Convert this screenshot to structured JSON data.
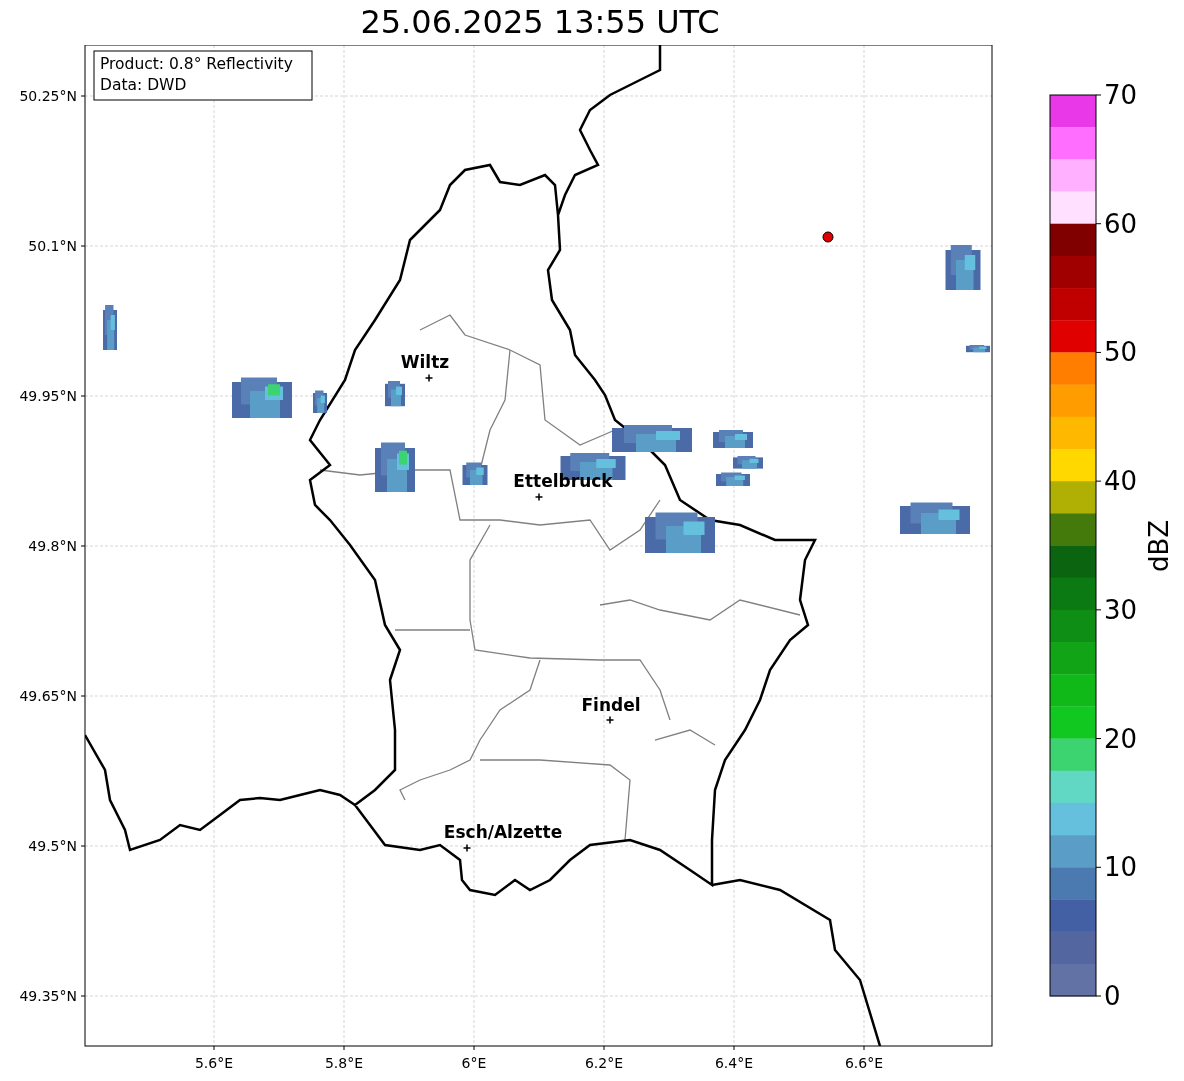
{
  "title": "25.06.2025 13:55 UTC",
  "info_box": [
    "Product: 0.8° Reflectivity",
    "Data: DWD"
  ],
  "map": {
    "cities": [
      {
        "name": "Wiltz"
      },
      {
        "name": "Ettelbruck"
      },
      {
        "name": "Findel"
      },
      {
        "name": "Esch/Alzette"
      }
    ],
    "x_ticks": [
      "5.6°E",
      "5.8°E",
      "6°E",
      "6.2°E",
      "6.4°E",
      "6.6°E"
    ],
    "y_ticks": [
      "50.25°N",
      "50.1°N",
      "49.95°N",
      "49.8°N",
      "49.65°N",
      "49.5°N",
      "49.35°N"
    ]
  },
  "colorbar": {
    "label": "dBZ",
    "ticks": [
      "70",
      "60",
      "50",
      "40",
      "30",
      "20",
      "10",
      "0"
    ],
    "segments": [
      {
        "color": "#e838e8"
      },
      {
        "color": "#ff6eff"
      },
      {
        "color": "#ffb0ff"
      },
      {
        "color": "#ffe0ff"
      },
      {
        "color": "#800000"
      },
      {
        "color": "#a00000"
      },
      {
        "color": "#c00000"
      },
      {
        "color": "#e00000"
      },
      {
        "color": "#ff7e00"
      },
      {
        "color": "#ff9c00"
      },
      {
        "color": "#ffb800"
      },
      {
        "color": "#ffd800"
      },
      {
        "color": "#b0b004"
      },
      {
        "color": "#447a0c"
      },
      {
        "color": "#0a6410"
      },
      {
        "color": "#0c7a12"
      },
      {
        "color": "#0e8e14"
      },
      {
        "color": "#10a416"
      },
      {
        "color": "#10b818"
      },
      {
        "color": "#10c820"
      },
      {
        "color": "#3cd470"
      },
      {
        "color": "#60d8c4"
      },
      {
        "color": "#64c0dc"
      },
      {
        "color": "#5a9ec8"
      },
      {
        "color": "#4a7ab0"
      },
      {
        "color": "#4460a4"
      },
      {
        "color": "#5466a0"
      },
      {
        "color": "#6272a4"
      }
    ]
  }
}
